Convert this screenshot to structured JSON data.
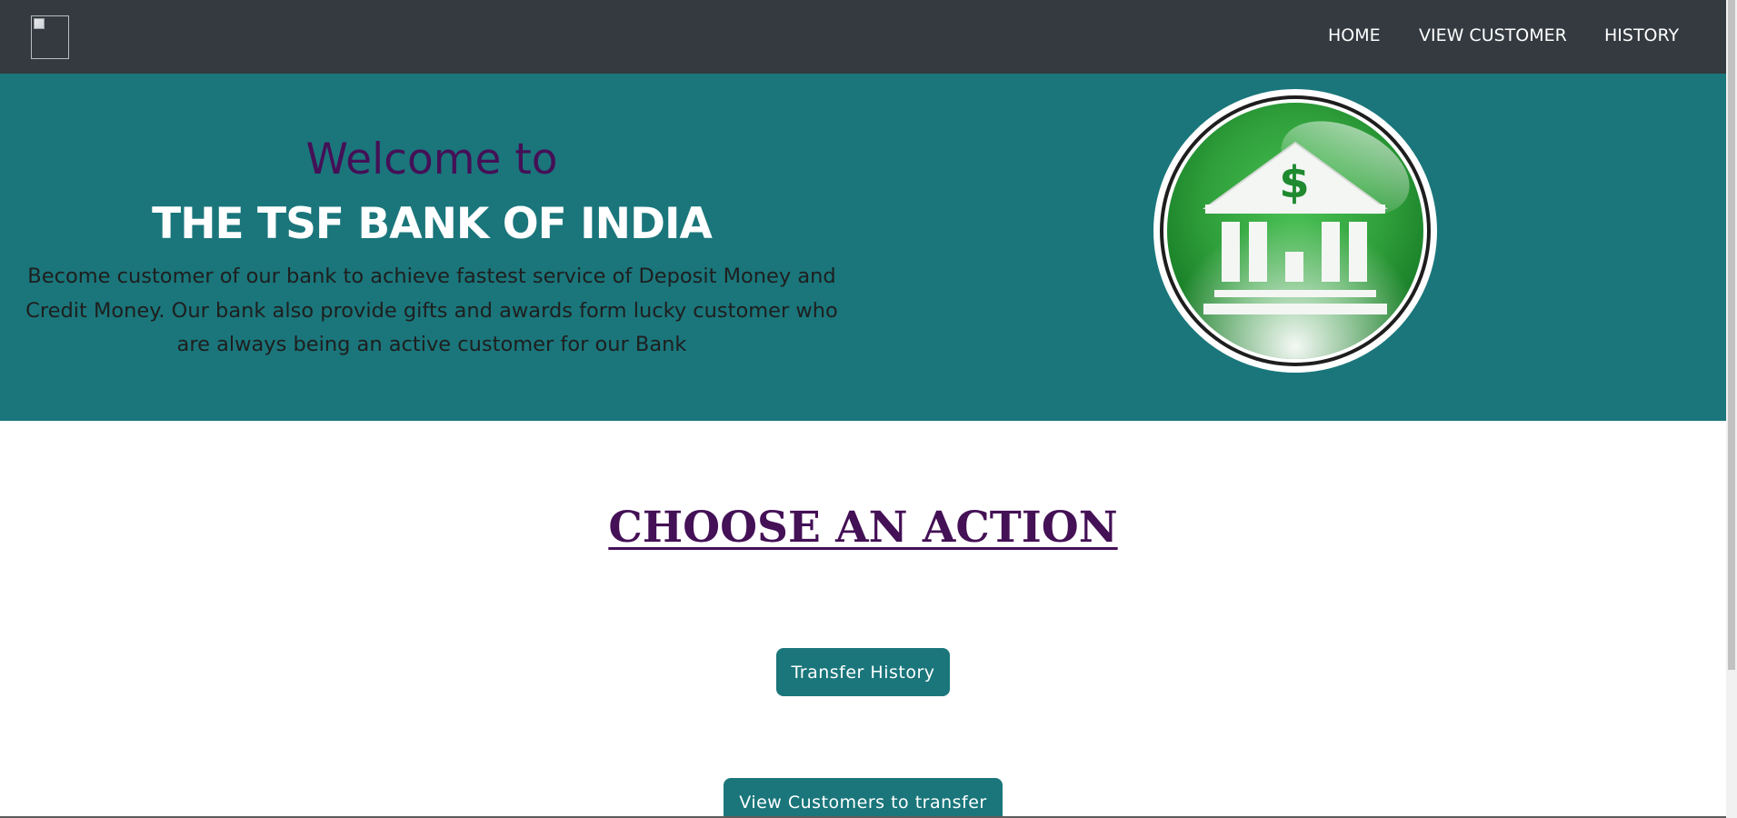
{
  "navbar": {
    "logo_alt": "",
    "links": [
      {
        "label": "HOME"
      },
      {
        "label": "VIEW CUSTOMER"
      },
      {
        "label": "HISTORY"
      }
    ]
  },
  "hero": {
    "welcome": "Welcome to",
    "bank_name": "THE TSF BANK OF INDIA",
    "tagline": "Become customer of our bank to achieve fastest service of Deposit Money and Credit Money. Our bank also provide gifts and awards form lucky customer who are always being an active customer for our Bank",
    "image_icon": "bank-building-dollar-icon",
    "dollar_sign": "$"
  },
  "main": {
    "title": "CHOOSE AN ACTION",
    "buttons": [
      {
        "label": "Transfer History"
      },
      {
        "label": "View Customers to transfer"
      }
    ]
  },
  "colors": {
    "navbar_bg": "#343a40",
    "hero_bg": "#1a767b",
    "accent_purple": "#441056",
    "button_bg": "#1a767b",
    "icon_green": "#2e9e3a"
  }
}
